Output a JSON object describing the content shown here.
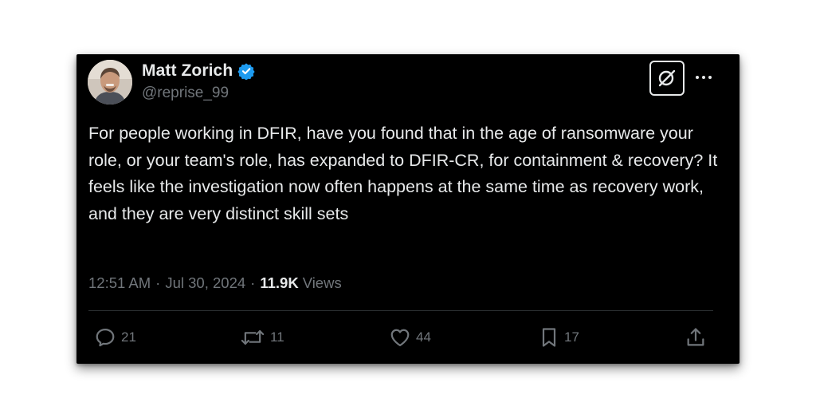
{
  "author": {
    "display_name": "Matt Zorich",
    "handle": "@reprise_99",
    "verified": true,
    "verified_color": "#1d9bf0"
  },
  "tweet": {
    "text": "For people working in DFIR, have you found that in the age of ransomware your role, or your team's role, has expanded to DFIR-CR, for containment & recovery? It feels like the investigation now often happens at the same time as recovery work, and they are very distinct skill sets",
    "time": "12:51 AM",
    "separator": "·",
    "date": "Jul 30, 2024",
    "views_count": "11.9K",
    "views_label": "Views"
  },
  "actions": {
    "replies": "21",
    "reposts": "11",
    "likes": "44",
    "bookmarks": "17"
  },
  "icons": {
    "grok": "grok-icon",
    "more": "more-icon",
    "reply": "reply-icon",
    "repost": "repost-icon",
    "like": "heart-icon",
    "bookmark": "bookmark-icon",
    "share": "share-icon"
  },
  "colors": {
    "background": "#000000",
    "text": "#e7e9ea",
    "muted": "#71767b",
    "divider": "#2f3336"
  }
}
